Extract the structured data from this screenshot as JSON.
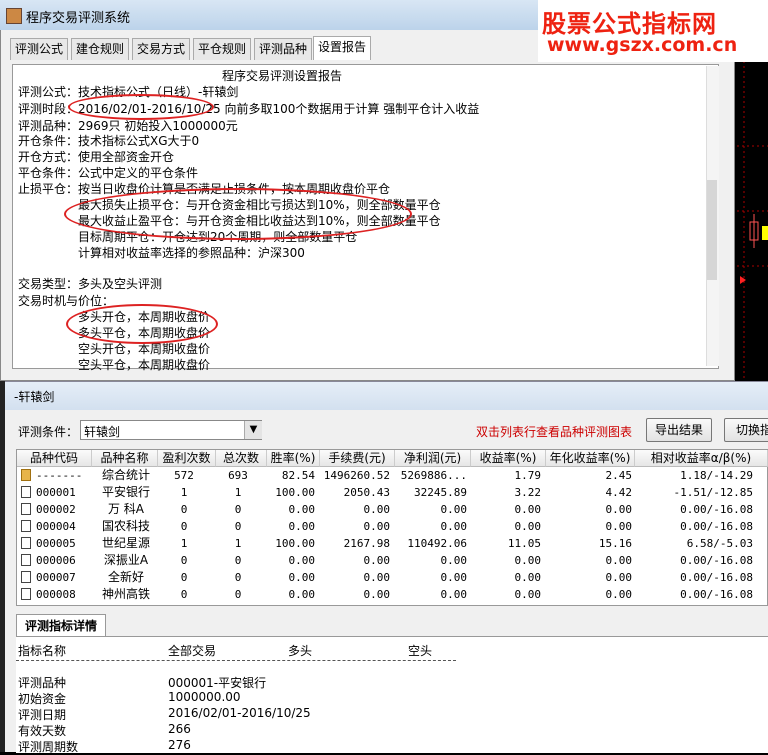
{
  "dialog": {
    "title": "程序交易评测系统",
    "tabs": [
      "评测公式",
      "建仓规则",
      "交易方式",
      "平仓规则",
      "评测品种",
      "设置报告"
    ],
    "active_tab": "设置报告",
    "report_lines": [
      "程序交易评测设置报告",
      "评测公式：技术指标公式（日线）-轩辕剑",
      "评测时段：2016/02/01-2016/10/25 向前多取100个数据用于计算 强制平仓计入收益",
      "评测品种：2969只 初始投入1000000元",
      "开仓条件：技术指标公式XG大于0",
      "开仓方式：使用全部资金开仓",
      "平仓条件：公式中定义的平仓条件",
      "止损平仓：按当日收盘价计算是否满足止损条件，按本周期收盘价平仓",
      "最大损失止损平仓：与开仓资金相比亏损达到10%，则全部数量平仓",
      "最大收益止盈平仓：与开仓资金相比收益达到10%，则全部数量平仓",
      "目标周期平仓：开仓达到20个周期，则全部数量平仓",
      "计算相对收益率选择的参照品种：沪深300",
      "交易类型：多头及空头评测",
      "交易时机与价位：",
      "多头开仓，本周期收盘价",
      "多头平仓，本周期收盘价",
      "空头开仓，本周期收盘价",
      "空头平仓，本周期收盘价"
    ]
  },
  "watermark": {
    "line1": "股票公式指标网",
    "line2": "www.gszx.com.cn"
  },
  "results_window": {
    "title": "-轩辕剑",
    "condition_label": "评测条件：",
    "condition_value": "轩辕剑",
    "hint": "双击列表行查看品种评测图表",
    "export_button": "导出结果",
    "switch_button": "切换指",
    "columns": [
      "品种代码",
      "品种名称",
      "盈利次数",
      "总次数",
      "胜率(%)",
      "手续费(元)",
      "净利润(元)",
      "收益率(%)",
      "年化收益率(%)",
      "相对收益率α/β(%)"
    ],
    "rows": [
      [
        "-------",
        "综合统计",
        "572",
        "693",
        "82.54",
        "1496260.52",
        "5269886...",
        "1.79",
        "2.45",
        "1.18/-14.29"
      ],
      [
        "000001",
        "平安银行",
        "1",
        "1",
        "100.00",
        "2050.43",
        "32245.89",
        "3.22",
        "4.42",
        "-1.51/-12.85"
      ],
      [
        "000002",
        "万 科A",
        "0",
        "0",
        "0.00",
        "0.00",
        "0.00",
        "0.00",
        "0.00",
        "0.00/-16.08"
      ],
      [
        "000004",
        "国农科技",
        "0",
        "0",
        "0.00",
        "0.00",
        "0.00",
        "0.00",
        "0.00",
        "0.00/-16.08"
      ],
      [
        "000005",
        "世纪星源",
        "1",
        "1",
        "100.00",
        "2167.98",
        "110492.06",
        "11.05",
        "15.16",
        "6.58/-5.03"
      ],
      [
        "000006",
        "深振业A",
        "0",
        "0",
        "0.00",
        "0.00",
        "0.00",
        "0.00",
        "0.00",
        "0.00/-16.08"
      ],
      [
        "000007",
        "全新好",
        "0",
        "0",
        "0.00",
        "0.00",
        "0.00",
        "0.00",
        "0.00",
        "0.00/-16.08"
      ],
      [
        "000008",
        "神州高铁",
        "0",
        "0",
        "0.00",
        "0.00",
        "0.00",
        "0.00",
        "0.00",
        "0.00/-16.08"
      ]
    ],
    "detail_tab": "评测指标详情",
    "detail_header": [
      "指标名称",
      "全部交易",
      "多头",
      "空头"
    ],
    "detail_rows": [
      [
        "评测品种",
        "000001-平安银行"
      ],
      [
        "初始资金",
        "1000000.00"
      ],
      [
        "评测日期",
        "2016/02/01-2016/10/25"
      ],
      [
        "有效天数",
        "266"
      ],
      [
        "评测周期数",
        "276"
      ]
    ]
  },
  "colors": {
    "annotation": "#d22222",
    "watermark": "#e02010",
    "hint": "#cc0000"
  }
}
